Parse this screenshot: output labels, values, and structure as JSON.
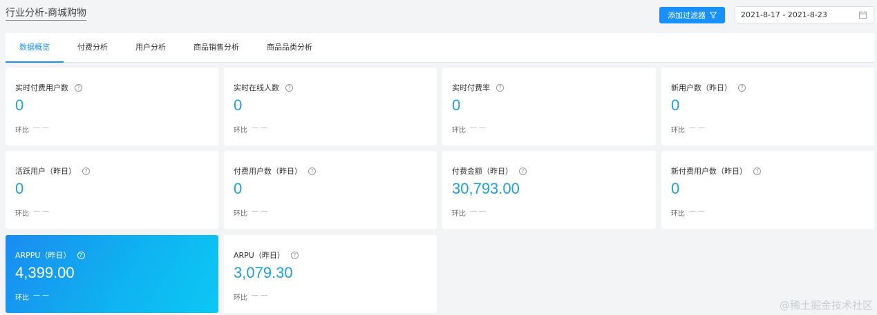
{
  "header": {
    "title": "行业分析-商城购物",
    "filter_button": "添加过滤器",
    "date_range": "2021-8-17 - 2021-8-23"
  },
  "tabs": [
    {
      "label": "数据概览",
      "active": true
    },
    {
      "label": "付费分析",
      "active": false
    },
    {
      "label": "用户分析",
      "active": false
    },
    {
      "label": "商品销售分析",
      "active": false
    },
    {
      "label": "商品品类分析",
      "active": false
    }
  ],
  "metrics": [
    {
      "label": "实时付费用户数",
      "value": "0",
      "compare_label": "环比",
      "compare_value": "— —"
    },
    {
      "label": "实时在线人数",
      "value": "0",
      "compare_label": "环比",
      "compare_value": "— —"
    },
    {
      "label": "实时付费率",
      "value": "0",
      "compare_label": "环比",
      "compare_value": "— —"
    },
    {
      "label": "新用户数（昨日）",
      "value": "0",
      "compare_label": "环比",
      "compare_value": "— —"
    },
    {
      "label": "活跃用户（昨日）",
      "value": "0",
      "compare_label": "环比",
      "compare_value": "— —"
    },
    {
      "label": "付费用户数（昨日）",
      "value": "0",
      "compare_label": "环比",
      "compare_value": "— —"
    },
    {
      "label": "付费金额（昨日）",
      "value": "30,793.00",
      "compare_label": "环比",
      "compare_value": "— —"
    },
    {
      "label": "新付费用户数（昨日）",
      "value": "0",
      "compare_label": "环比",
      "compare_value": "— —"
    },
    {
      "label": "ARPPU（昨日）",
      "value": "4,399.00",
      "compare_label": "环比",
      "compare_value": "— —"
    },
    {
      "label": "ARPU（昨日）",
      "value": "3,079.30",
      "compare_label": "环比",
      "compare_value": "— —"
    }
  ],
  "help_icon_glyph": "?",
  "watermark": "@稀土掘金技术社区",
  "colors": {
    "accent": "#1890ff",
    "value": "#1ea1e3",
    "highlight_gradient_start": "#1a8cf0",
    "highlight_gradient_end": "#0cc8f5"
  }
}
